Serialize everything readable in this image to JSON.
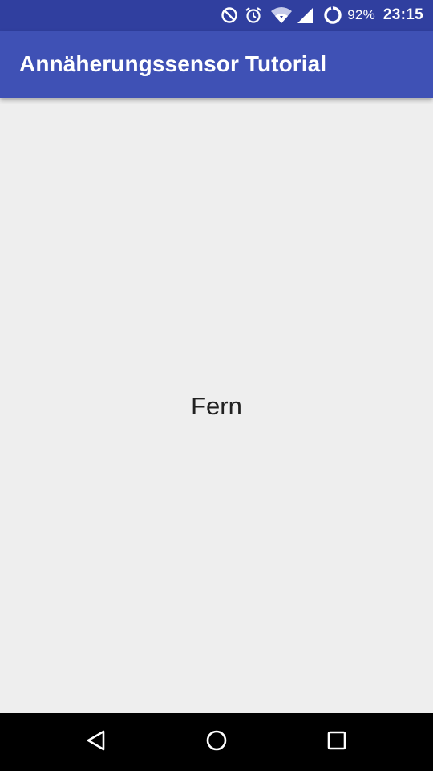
{
  "status_bar": {
    "icons": [
      "do-not-disturb-icon",
      "alarm-icon",
      "wifi-icon",
      "cell-signal-icon",
      "battery-icon"
    ],
    "battery_percent": "92%",
    "time": "23:15",
    "background_color": "#303f9f"
  },
  "app_bar": {
    "title": "Annäherungssensor Tutorial",
    "background_color": "#3f51b5"
  },
  "content": {
    "sensor_state": "Fern",
    "background_color": "#eeeeee"
  },
  "nav_bar": {
    "buttons": [
      "back-icon",
      "home-icon",
      "recents-icon"
    ]
  }
}
